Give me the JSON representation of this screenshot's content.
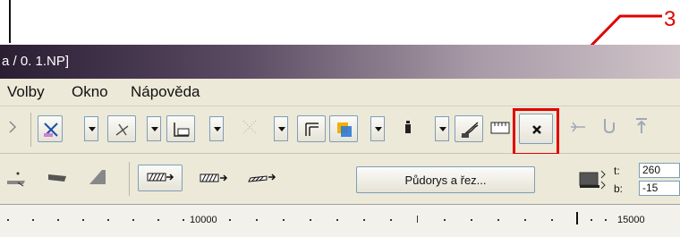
{
  "callout": {
    "number": "3",
    "color": "#e00000"
  },
  "window": {
    "title_fragment": "a / 0. 1.NP]"
  },
  "menu": {
    "items": [
      "Volby",
      "Okno",
      "Nápověda"
    ]
  },
  "toolbar1": {
    "icons": [
      "snap-icon",
      "magic-wand-icon",
      "guide-line-icon",
      "label-icon",
      "grid-dots-icon",
      "corner-icon",
      "layer-color-icon",
      "marker-icon",
      "stair-icon",
      "ruler-icon",
      "close-x-icon",
      "trace-icon",
      "hook-icon",
      "arrange-top-icon"
    ]
  },
  "toolbar2": {
    "icons": [
      "wall-tool-icon",
      "slab-tool-icon",
      "roof-tool-icon",
      "hatch-arrow-icon",
      "dashed-arrow-icon",
      "pattern-arrow-icon"
    ],
    "plan_section_button": "Půdorys a řez...",
    "t_label": "t:",
    "b_label": "b:",
    "t_value": "260",
    "b_value": "-15"
  },
  "ruler": {
    "labels": [
      "10000",
      "15000"
    ]
  },
  "colors": {
    "highlight": "#e00000",
    "toolbar_bg": "#ece9d8"
  }
}
